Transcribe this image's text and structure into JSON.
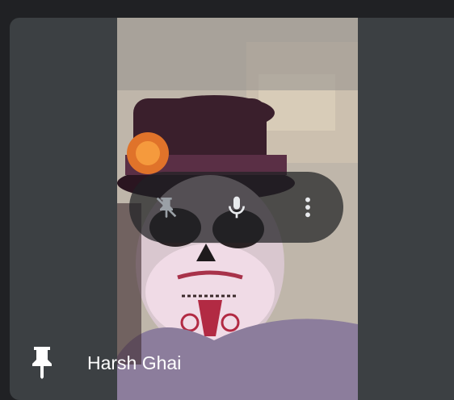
{
  "participant": {
    "name": "Harsh Ghai"
  },
  "icons": {
    "pin_indicator": "pin-icon",
    "unpin": "pin-off-icon",
    "microphone": "microphone-icon",
    "more_options": "more-vert-icon"
  },
  "colors": {
    "page_background": "#202124",
    "tile_background": "#3c4043",
    "controls_background": "#202124",
    "text": "#ffffff"
  }
}
